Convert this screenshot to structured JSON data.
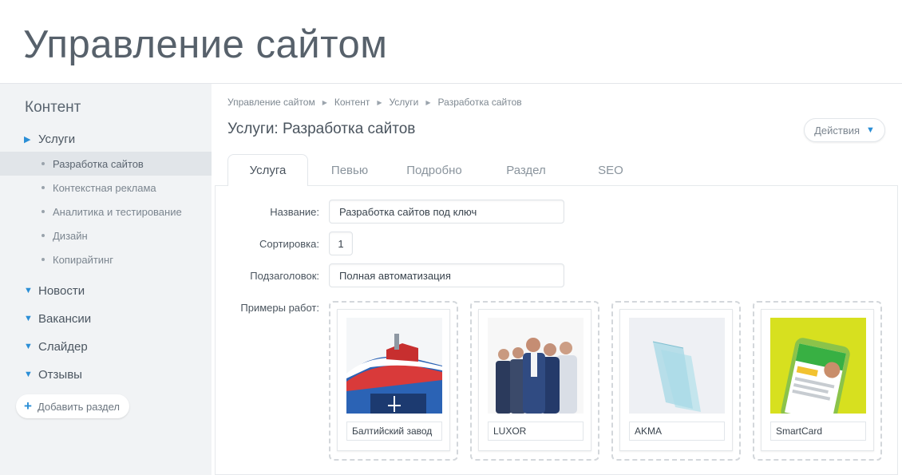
{
  "app": {
    "title": "Управление сайтом"
  },
  "sidebar": {
    "title": "Контент",
    "sections": [
      {
        "label": "Услуги",
        "expanded": true,
        "items": [
          {
            "label": "Разработка сайтов",
            "active": true
          },
          {
            "label": "Контекстная реклама"
          },
          {
            "label": "Аналитика и тестирование"
          },
          {
            "label": "Дизайн"
          },
          {
            "label": "Копирайтинг"
          }
        ]
      },
      {
        "label": "Новости"
      },
      {
        "label": "Вакансии"
      },
      {
        "label": "Слайдер"
      },
      {
        "label": "Отзывы"
      }
    ],
    "add_section_label": "Добавить раздел"
  },
  "breadcrumb": [
    "Управление сайтом",
    "Контент",
    "Услуги",
    "Разработка сайтов"
  ],
  "page": {
    "title": "Услуги: Разработка сайтов",
    "actions_label": "Действия"
  },
  "tabs": [
    {
      "label": "Услуга",
      "active": true
    },
    {
      "label": "Певью"
    },
    {
      "label": "Подробно"
    },
    {
      "label": "Раздел"
    },
    {
      "label": "SEO"
    }
  ],
  "form": {
    "name_label": "Название:",
    "name_value": "Разработка сайтов под ключ",
    "sort_label": "Сортировка:",
    "sort_value": "1",
    "subtitle_label": "Подзаголовок:",
    "subtitle_value": "Полная автоматизация",
    "works_label": "Примеры работ:"
  },
  "works": [
    {
      "caption": "Балтийский завод",
      "image": "icebreaker-ship"
    },
    {
      "caption": "LUXOR",
      "image": "team-photo"
    },
    {
      "caption": "AKMA",
      "image": "glass-panels"
    },
    {
      "caption": "SmartCard",
      "image": "smartphone-app"
    }
  ],
  "colors": {
    "accent": "#2a8ed6",
    "sidebar_bg": "#f1f3f5",
    "active_item_bg": "#e1e5e9"
  }
}
